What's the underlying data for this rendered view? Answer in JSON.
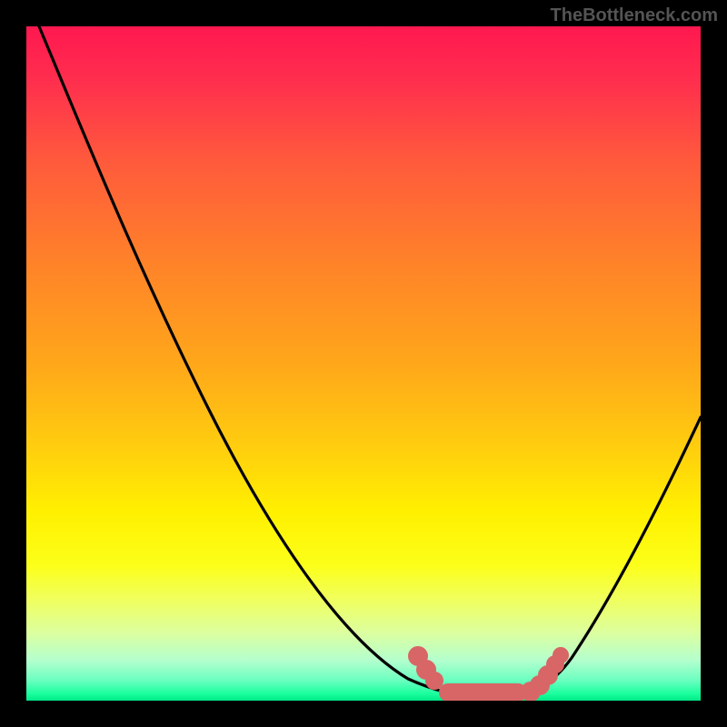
{
  "watermark": "TheBottleneck.com",
  "chart_data": {
    "type": "line",
    "title": "",
    "xlabel": "",
    "ylabel": "",
    "xlim": [
      0,
      100
    ],
    "ylim": [
      0,
      100
    ],
    "series": [
      {
        "name": "bottleneck-curve",
        "x": [
          0,
          5,
          10,
          15,
          20,
          25,
          30,
          35,
          40,
          45,
          50,
          55,
          60,
          62,
          65,
          70,
          75,
          80,
          85,
          90,
          95,
          100
        ],
        "y": [
          100,
          96,
          90,
          84,
          77,
          70,
          62,
          54,
          46,
          37,
          28,
          19,
          10,
          6,
          1,
          0,
          0,
          2,
          8,
          18,
          30,
          44
        ]
      }
    ],
    "highlight_region": {
      "name": "optimal-zone",
      "x": [
        59,
        62,
        64,
        66,
        70,
        74,
        77,
        79,
        80
      ],
      "y": [
        12,
        5,
        2,
        1,
        0,
        0,
        1,
        3,
        6
      ]
    },
    "colors": {
      "curve": "#000000",
      "highlight": "#d86666",
      "gradient_top": "#ff1850",
      "gradient_bottom": "#00e887"
    }
  }
}
